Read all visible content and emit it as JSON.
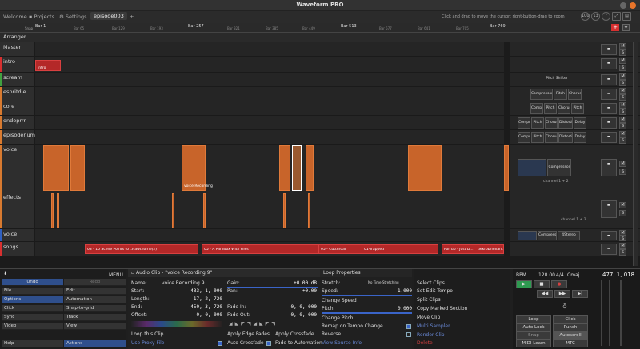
{
  "app": {
    "title": "Waveform PRO",
    "hint": "Click and drag to move the cursor; right-button-drag to zoom",
    "tabs": [
      "Welcome",
      "Projects",
      "Settings",
      "episode003"
    ],
    "add_tab": "+",
    "icons": [
      "100",
      "13",
      "?"
    ]
  },
  "ruler": {
    "labels": [
      "Bar 1",
      "Bar 257",
      "Bar 513",
      "Bar 769"
    ],
    "small": [
      "Bar 65",
      "Bar 129",
      "Bar 193",
      "Bar 321",
      "Bar 385",
      "Bar 449",
      "Bar 577",
      "Bar 641",
      "Bar 705"
    ],
    "snap": "Snap"
  },
  "tracks": [
    {
      "name": "Arranger",
      "color": "#888888"
    },
    {
      "name": "Master",
      "color": "#888888"
    },
    {
      "name": "intro",
      "color": "#d83030"
    },
    {
      "name": "scream",
      "color": "#40a040"
    },
    {
      "name": "espritdle",
      "color": "#d87a30"
    },
    {
      "name": "core",
      "color": "#d87a30"
    },
    {
      "name": "ondeprrr",
      "color": "#d87a30"
    },
    {
      "name": "episodenumero",
      "color": "#d87a30"
    },
    {
      "name": "voice",
      "color": "#d87a30"
    },
    {
      "name": "effects",
      "color": "#d87a30"
    },
    {
      "name": "voice",
      "color": "#3060c0"
    },
    {
      "name": "songs",
      "color": "#d83030"
    }
  ],
  "clips": {
    "intro": "intro",
    "voice_rec": "voice Recording",
    "songs": [
      "03 - 10 Scene Points to ...",
      "Hawthorne(2)",
      "05 - A Paradox With Files",
      "05 - Cutthroat",
      "01-Trapped",
      "Porrup - Just D...",
      "dekrobrimiant"
    ]
  },
  "plugins": {
    "scream": [
      "Pitch Shifter"
    ],
    "espritdle": [
      "Compressor",
      "Pitch Shifter",
      "Chorus"
    ],
    "core": [
      "Compr...",
      "Pitch Shifter",
      "Chorus",
      "Pitch Shifter"
    ],
    "ondeprrr": [
      "Compr...",
      "Pitch Shifter",
      "Chorus",
      "Distortion",
      "Delay"
    ],
    "episodenumero": [
      "Compr...",
      "Pitch Shifter",
      "Chorus",
      "Distortion",
      "Delay"
    ],
    "voice": [
      "Compressor"
    ],
    "voice_channel": "channel 1 + 2",
    "effects_channel": "channel 1 + 2",
    "voice2": [
      "Compressor",
      "4Stereo Delay"
    ],
    "mute": "M",
    "solo": "S"
  },
  "left_panel": {
    "header_icon": "⬇",
    "menu": "MENU",
    "undo": "Undo",
    "redo": "Redo",
    "items": [
      [
        "File",
        "Edit"
      ],
      [
        "Options",
        "Automation"
      ],
      [
        "Click",
        "Snap-to-grid"
      ],
      [
        "Sync",
        "Track"
      ],
      [
        "Video",
        "View"
      ],
      [
        "Help",
        "Actions"
      ]
    ]
  },
  "clip_panel": {
    "title": "Audio Clip - \"voice Recording 9\"",
    "tab2": "Loop Properties",
    "name_label": "Name:",
    "name_value": "voice Recording 9",
    "start_label": "Start:",
    "start_value": "433, 1, 000",
    "length_label": "Length:",
    "length_value": "17, 2, 720",
    "end_label": "End:",
    "end_value": "450, 3, 720",
    "offset_label": "Offset:",
    "offset_value": "0, 0, 000",
    "gain_label": "Gain:",
    "gain_value": "+0.00 dB",
    "pan_label": "Pan:",
    "pan_value": "+0.00",
    "fadein_label": "Fade In:",
    "fadein_value": "0, 0, 000",
    "fadeout_label": "Fade Out:",
    "fadeout_value": "0, 0, 000",
    "loop_clip": "Loop this Clip",
    "proxy": "Use Proxy File",
    "edge_fades": "Apply Edge Fades",
    "crossfade": "Apply Crossfade",
    "auto_crossfade": "Auto Crossfade",
    "fade_auto": "Fade to Automation",
    "stretch_label": "Stretch:",
    "stretch_value": "No Time-Stretching",
    "speed_label": "Speed:",
    "speed_value": "1.000",
    "change_speed": "Change Speed",
    "pitch_label": "Pitch:",
    "pitch_value": "0.000",
    "change_pitch": "Change Pitch",
    "remap": "Remap on Tempo Change",
    "reverse": "Reverse",
    "view_source": "View Source Info"
  },
  "actions": [
    "Select Clips",
    "Set Edit Tempo",
    "Split Clips",
    "Copy Marked Section",
    "Move Clip",
    "Multi Sampler",
    "Render Clip",
    "Delete"
  ],
  "transport": {
    "bpm_label": "BPM",
    "bpm": "120.00",
    "sig": "4/4",
    "key": "Cmaj",
    "position": "477, 1, 018",
    "buttons": [
      "Loop",
      "Click",
      "Auto Lock",
      "Punch",
      "Snap",
      "Autoscroll",
      "MIDI Learn",
      "MTC"
    ]
  },
  "colors": {
    "accent": "#3a64c8",
    "clip": "#c8642a",
    "record": "#d83030"
  }
}
